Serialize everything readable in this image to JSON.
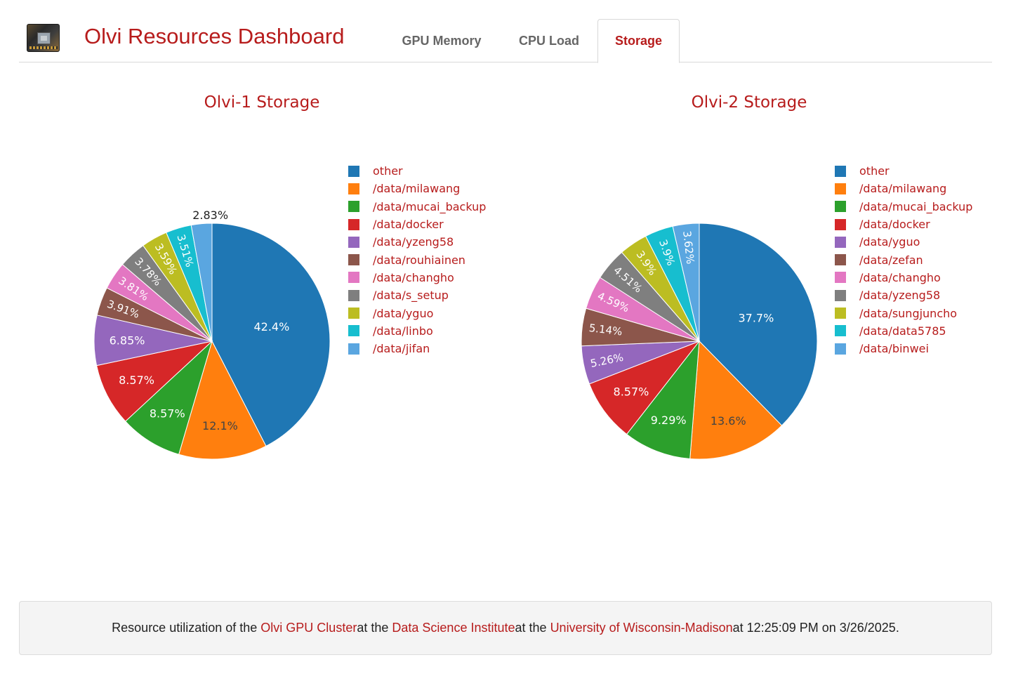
{
  "header": {
    "title": "Olvi Resources Dashboard",
    "logo_icon": "gpu-chip-icon",
    "tabs": [
      {
        "label": "GPU Memory",
        "active": false
      },
      {
        "label": "CPU Load",
        "active": false
      },
      {
        "label": "Storage",
        "active": true
      }
    ]
  },
  "colors": {
    "accent": "#b71c1c",
    "palette": [
      "#1f77b4",
      "#ff7f0e",
      "#2ca02c",
      "#d62728",
      "#9467bd",
      "#8c564b",
      "#e377c2",
      "#7f7f7f",
      "#bcbd22",
      "#17becf",
      "#5aa6e0"
    ]
  },
  "chart_data": [
    {
      "type": "pie",
      "title": "Olvi-1 Storage",
      "labels": [
        "other",
        "/data/milawang",
        "/data/mucai_backup",
        "/data/docker",
        "/data/yzeng58",
        "/data/rouhiainen",
        "/data/changho",
        "/data/s_setup",
        "/data/yguo",
        "/data/linbo",
        "/data/jifan"
      ],
      "values": [
        42.4,
        12.1,
        8.57,
        8.57,
        6.85,
        3.91,
        3.81,
        3.78,
        3.59,
        3.51,
        2.83
      ],
      "value_labels": [
        "42.4%",
        "12.1%",
        "8.57%",
        "8.57%",
        "6.85%",
        "3.91%",
        "3.81%",
        "3.78%",
        "3.59%",
        "3.51%",
        "2.83%"
      ],
      "legend_position": "right"
    },
    {
      "type": "pie",
      "title": "Olvi-2 Storage",
      "labels": [
        "other",
        "/data/milawang",
        "/data/mucai_backup",
        "/data/docker",
        "/data/yguo",
        "/data/zefan",
        "/data/changho",
        "/data/yzeng58",
        "/data/sungjuncho",
        "/data/data5785",
        "/data/binwei"
      ],
      "values": [
        37.7,
        13.6,
        9.29,
        8.57,
        5.26,
        5.14,
        4.59,
        4.51,
        3.9,
        3.9,
        3.62
      ],
      "value_labels": [
        "37.7%",
        "13.6%",
        "9.29%",
        "8.57%",
        "5.26%",
        "5.14%",
        "4.59%",
        "4.51%",
        "3.9%",
        "3.9%",
        "3.62%"
      ],
      "legend_position": "right"
    }
  ],
  "footer": {
    "prefix": "Resource utilization of the ",
    "link1": "Olvi GPU Cluster",
    "mid1": " at the ",
    "link2": "Data Science Institute",
    "mid2": " at the ",
    "link3": "University of Wisconsin-Madison",
    "suffix": " at 12:25:09 PM on 3/26/2025."
  }
}
